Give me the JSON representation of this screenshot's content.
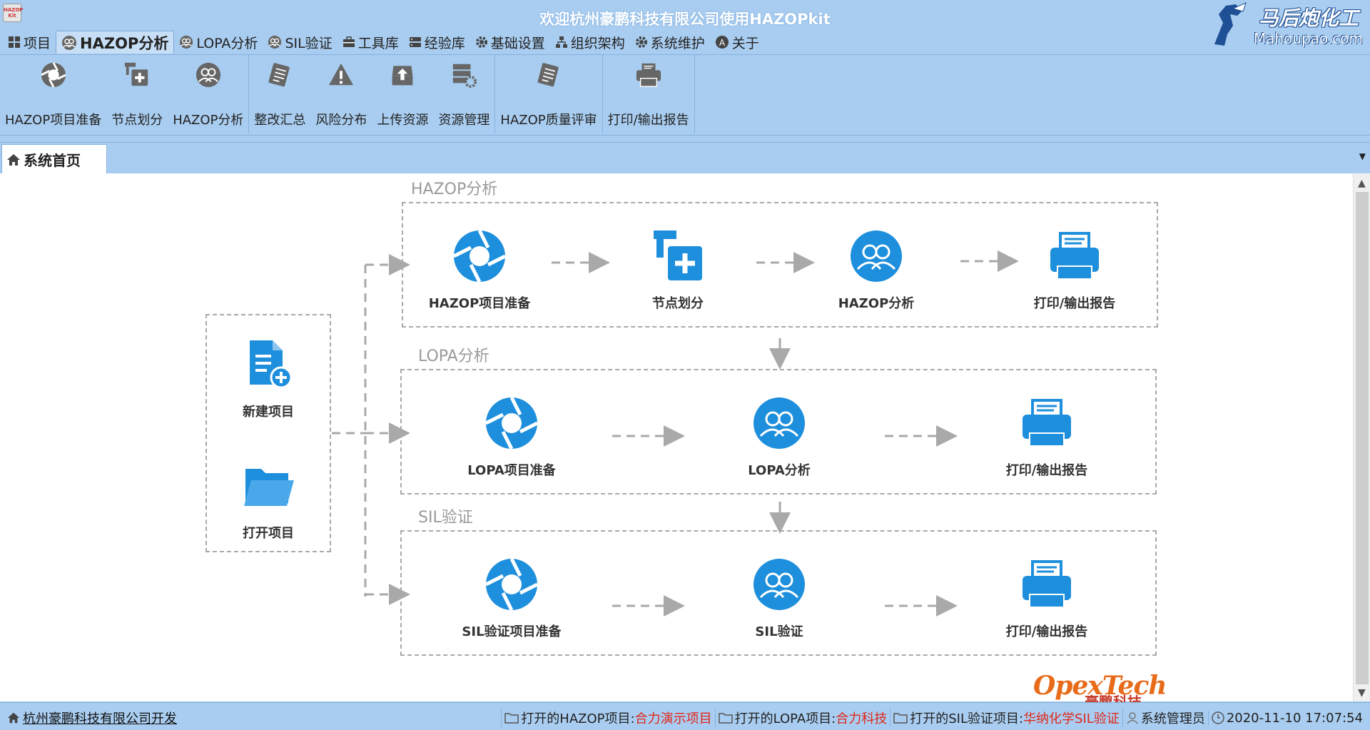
{
  "window": {
    "title": "欢迎杭州豪鹏科技有限公司使用HAZOPkit",
    "logo_text": "HAZOP Kit"
  },
  "watermark": {
    "line1": "马后炮化工",
    "line2": "Mahoupao.com"
  },
  "menu": [
    {
      "label": "项目",
      "icon": "grid-icon"
    },
    {
      "label": "HAZOP分析",
      "icon": "users-icon",
      "active": true
    },
    {
      "label": "LOPA分析",
      "icon": "users-icon"
    },
    {
      "label": "SIL验证",
      "icon": "users-icon"
    },
    {
      "label": "工具库",
      "icon": "toolbox-icon"
    },
    {
      "label": "经验库",
      "icon": "database-icon"
    },
    {
      "label": "基础设置",
      "icon": "gear-icon"
    },
    {
      "label": "组织架构",
      "icon": "org-chart-icon"
    },
    {
      "label": "系统维护",
      "icon": "gear-icon"
    },
    {
      "label": "关于",
      "icon": "info-icon"
    }
  ],
  "ribbon": {
    "groups": [
      [
        {
          "label": "HAZOP项目准备",
          "icon": "aperture-icon"
        },
        {
          "label": "节点划分",
          "icon": "node-add-icon"
        },
        {
          "label": "HAZOP分析",
          "icon": "users-circle-icon"
        }
      ],
      [
        {
          "label": "整改汇总",
          "icon": "clipboard-icon"
        },
        {
          "label": "风险分布",
          "icon": "warning-icon"
        },
        {
          "label": "上传资源",
          "icon": "upload-icon"
        },
        {
          "label": "资源管理",
          "icon": "server-gear-icon"
        }
      ],
      [
        {
          "label": "HAZOP质量评审",
          "icon": "clipboard-icon"
        }
      ],
      [
        {
          "label": "打印/输出报告",
          "icon": "printer-icon"
        }
      ]
    ]
  },
  "tabs": {
    "home_label": "系统首页"
  },
  "flow": {
    "left": {
      "new_project": "新建项目",
      "open_project": "打开项目"
    },
    "hazop": {
      "title": "HAZOP分析",
      "nodes": [
        "HAZOP项目准备",
        "节点划分",
        "HAZOP分析",
        "打印/输出报告"
      ]
    },
    "lopa": {
      "title": "LOPA分析",
      "nodes": [
        "LOPA项目准备",
        "LOPA分析",
        "打印/输出报告"
      ]
    },
    "sil": {
      "title": "SIL验证",
      "nodes": [
        "SIL验证项目准备",
        "SIL验证",
        "打印/输出报告"
      ]
    }
  },
  "branding": {
    "opex": "OpexTech",
    "opex_sub": "豪鹏科技"
  },
  "status": {
    "company": "杭州豪鹏科技有限公司开发",
    "hazop_label": "打开的HAZOP项目:",
    "hazop_value": "合力演示项目",
    "lopa_label": "打开的LOPA项目:",
    "lopa_value": "合力科技",
    "sil_label": "打开的SIL验证项目:",
    "sil_value": "华纳化学SIL验证",
    "user": "系统管理员",
    "datetime": "2020-11-10 17:07:54"
  },
  "colors": {
    "accent_blue": "#1e8fdc",
    "chrome": "#a9cdf0",
    "status_red": "#e0261a"
  }
}
